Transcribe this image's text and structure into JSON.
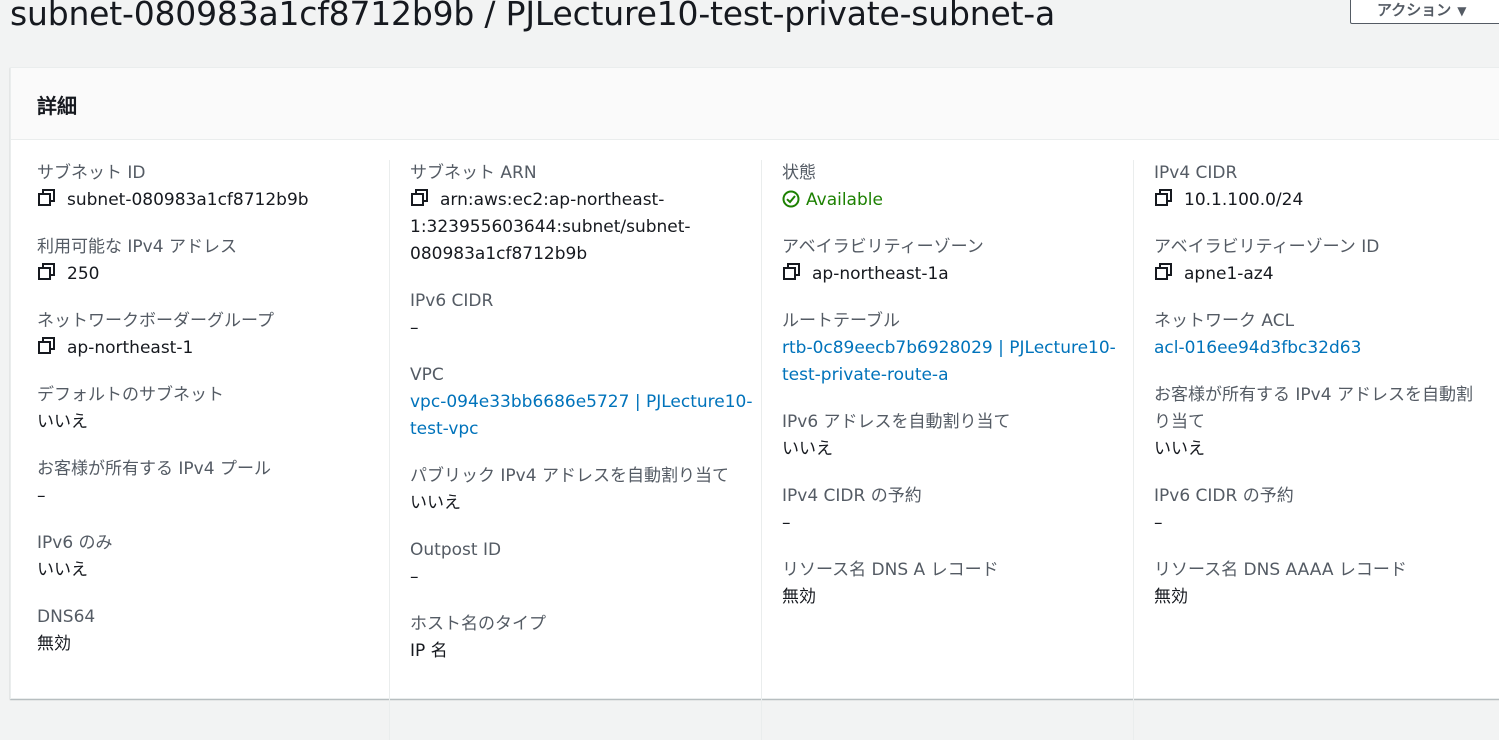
{
  "header": {
    "title": "subnet-080983a1cf8712b9b / PJLecture10-test-private-subnet-a",
    "action_label": "アクション"
  },
  "panel": {
    "title": "詳細"
  },
  "col1": [
    {
      "label": "サブネット ID",
      "value": "subnet-080983a1cf8712b9b"
    },
    {
      "label": "利用可能な IPv4 アドレス",
      "value": "250"
    },
    {
      "label": "ネットワークボーダーグループ",
      "value": "ap-northeast-1"
    },
    {
      "label": "デフォルトのサブネット",
      "value": "いいえ"
    },
    {
      "label": "お客様が所有する IPv4 プール",
      "value": "–"
    },
    {
      "label": "IPv6 のみ",
      "value": "いいえ"
    },
    {
      "label": "DNS64",
      "value": "無効"
    }
  ],
  "col2": [
    {
      "label": "サブネット ARN",
      "value_lines": [
        "arn:aws:ec2:ap-northeast-",
        "1:323955603644:subnet/subnet-",
        "080983a1cf8712b9b"
      ]
    },
    {
      "label": "IPv6 CIDR",
      "value": "–"
    },
    {
      "label": "VPC",
      "value_lines": [
        "vpc-094e33bb6686e5727 | PJLecture10-",
        "test-vpc"
      ]
    },
    {
      "label": "パブリック IPv4 アドレスを自動割り当て",
      "value": "いいえ"
    },
    {
      "label": "Outpost ID",
      "value": "–"
    },
    {
      "label": "ホスト名のタイプ",
      "value": "IP 名"
    }
  ],
  "col3": [
    {
      "label": "状態",
      "value": "Available"
    },
    {
      "label": "アベイラビリティーゾーン",
      "value": "ap-northeast-1a"
    },
    {
      "label": "ルートテーブル",
      "value_lines": [
        "rtb-0c89eecb7b6928029 | PJLecture10-",
        "test-private-route-a"
      ]
    },
    {
      "label": "IPv6 アドレスを自動割り当て",
      "value": "いいえ"
    },
    {
      "label": "IPv4 CIDR の予約",
      "value": "–"
    },
    {
      "label": "リソース名 DNS A レコード",
      "value": "無効"
    }
  ],
  "col4": [
    {
      "label": "IPv4 CIDR",
      "value": "10.1.100.0/24"
    },
    {
      "label": "アベイラビリティーゾーン ID",
      "value": "apne1-az4"
    },
    {
      "label": "ネットワーク ACL",
      "value": "acl-016ee94d3fbc32d63"
    },
    {
      "label_lines": [
        "お客様が所有する IPv4 アドレスを自動割",
        "り当て"
      ],
      "value": "いいえ"
    },
    {
      "label": "IPv6 CIDR の予約",
      "value": "–"
    },
    {
      "label": "リソース名 DNS AAAA レコード",
      "value": "無効"
    }
  ],
  "colors": {
    "link": "#0073bb",
    "success": "#1d8102",
    "label": "#545b64"
  }
}
